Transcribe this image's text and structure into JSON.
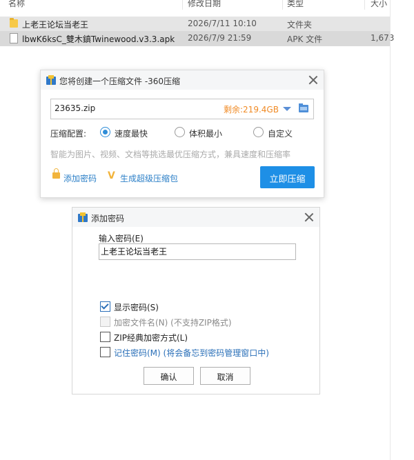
{
  "explorer": {
    "columns": {
      "name": "名称",
      "modified": "修改日期",
      "type": "类型",
      "size": "大小"
    },
    "files": [
      {
        "name": "上老王论坛当老王",
        "date": "2026/7/11 10:10",
        "type": "文件夹",
        "size": "",
        "icon": "folder-icon"
      },
      {
        "name": "lbwK6ksC_雙木鎮Twinewood.v3.3.apk",
        "date": "2026/7/9 21:59",
        "type": "APK 文件",
        "size": "1,673",
        "icon": "file-icon"
      }
    ]
  },
  "compress_dialog": {
    "title": "您将创建一个压缩文件 -360压缩",
    "filename": "23635.zip",
    "free_space": "剩余:219.4GB",
    "config_label": "压缩配置:",
    "options": [
      {
        "label": "速度最快",
        "selected": true
      },
      {
        "label": "体积最小",
        "selected": false
      },
      {
        "label": "自定义",
        "selected": false
      }
    ],
    "hint": "智能为图片、视频、文档等挑选最优压缩方式，兼具速度和压缩率",
    "add_password_link": "添加密码",
    "super_package_link": "生成超级压缩包",
    "compress_button": "立即压缩",
    "accent_color": "#1e8fe6"
  },
  "password_dialog": {
    "title": "添加密码",
    "input_label": "输入密码(E)",
    "password_value": "上老王论坛当老王",
    "checkboxes": [
      {
        "label": "显示密码(S)",
        "checked": true,
        "disabled": false
      },
      {
        "label": "加密文件名(N) (不支持ZIP格式)",
        "checked": false,
        "disabled": true
      },
      {
        "label": "ZIP经典加密方式(L)",
        "checked": false,
        "disabled": false
      },
      {
        "label": "记住密码(M) (将会备忘到密码管理窗口中)",
        "checked": false,
        "disabled": false
      }
    ],
    "ok_button": "确认",
    "cancel_button": "取消"
  }
}
